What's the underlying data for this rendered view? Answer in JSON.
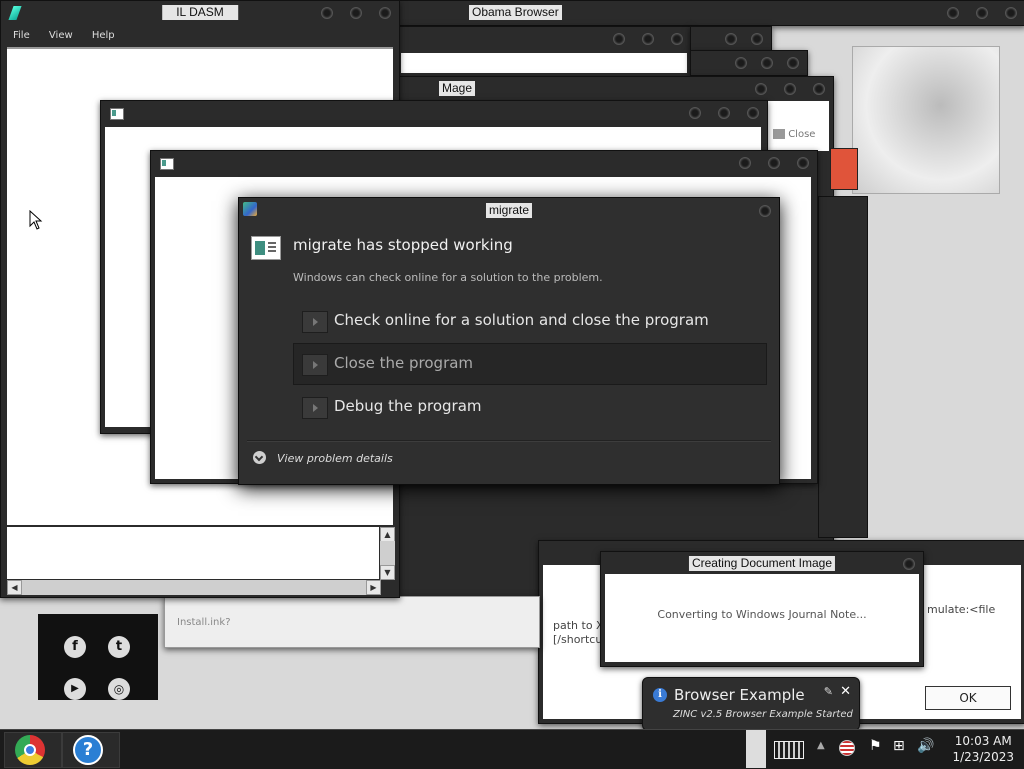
{
  "windows": {
    "ildasm": {
      "title": "IL DASM",
      "menu": [
        "File",
        "View",
        "Help"
      ]
    },
    "obama": {
      "title": "Obama Browser"
    },
    "mage": {
      "title": "Mage",
      "close_label": "Close"
    },
    "creating": {
      "title": "Creating Document Image",
      "message": "Converting to Windows Journal Note..."
    },
    "back_right": {
      "text_line1": "path to X",
      "text_line2": "[/shortcu",
      "text_frag": "mulate:<file",
      "ok_label": "OK",
      "install_frag": "Install.ink?"
    }
  },
  "error_dialog": {
    "title": "migrate",
    "heading": "migrate has stopped working",
    "subtext": "Windows can check online for a solution to the problem.",
    "options": [
      {
        "label": "Check online for a solution and close the program"
      },
      {
        "label": "Close the program"
      },
      {
        "label": "Debug the program"
      }
    ],
    "details_label": "View problem details"
  },
  "notification": {
    "title": "Browser Example",
    "message": "ZINC v2.5 Browser Example Started",
    "close_glyph": "✕",
    "pin_glyph": "✎"
  },
  "taskbar": {
    "time": "10:03 AM",
    "date": "1/23/2023",
    "help_glyph": "?"
  },
  "social": {
    "facebook": "f",
    "twitter": "t",
    "youtube": "▶",
    "instagram": "◎"
  }
}
